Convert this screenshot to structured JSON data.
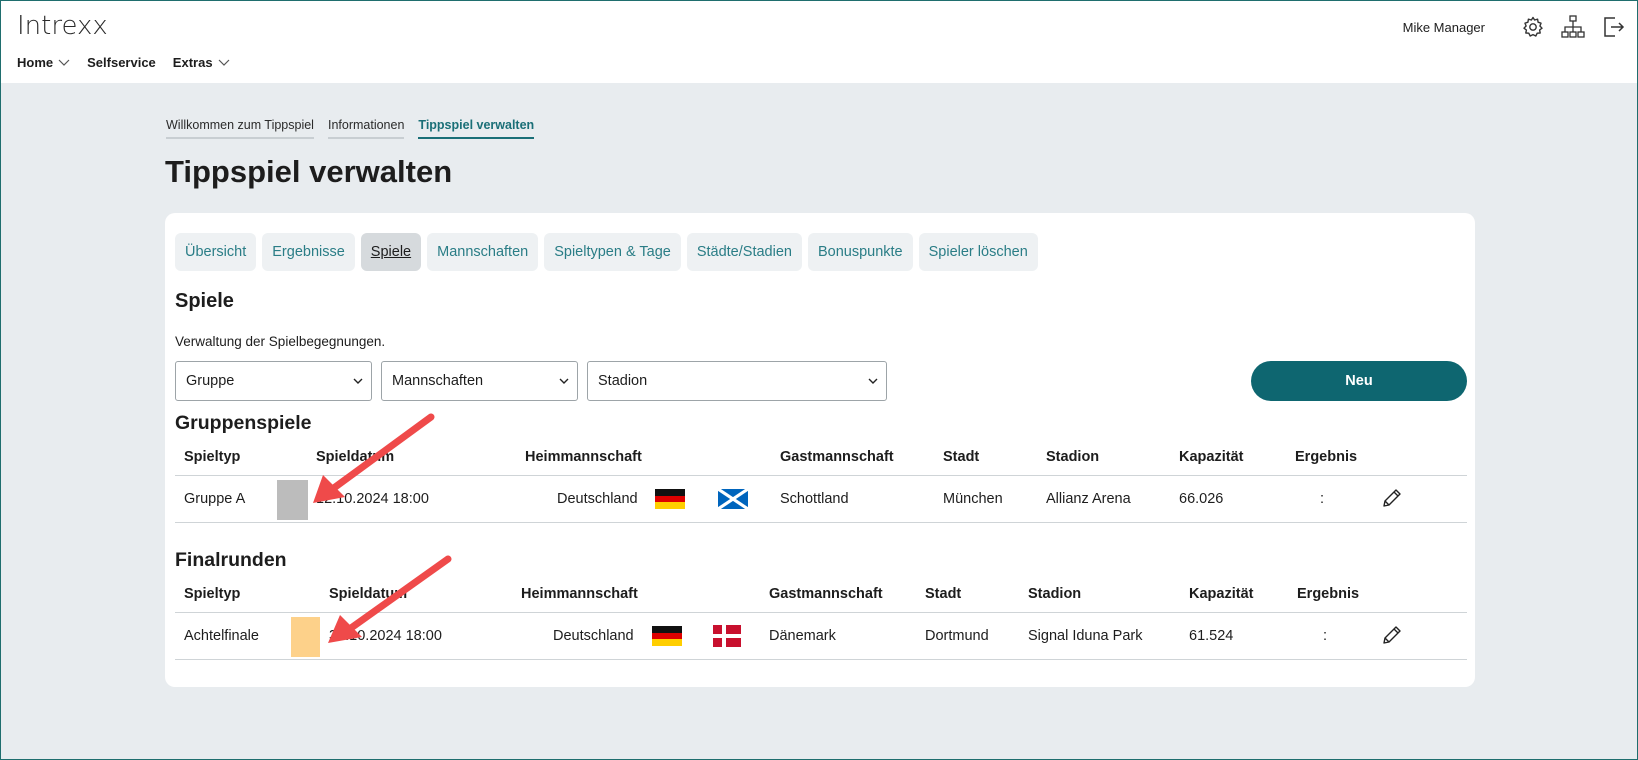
{
  "header": {
    "logo": "Intrexx",
    "nav": [
      {
        "label": "Home",
        "has_dropdown": true
      },
      {
        "label": "Selfservice",
        "has_dropdown": false
      },
      {
        "label": "Extras",
        "has_dropdown": true
      }
    ],
    "user_name": "Mike Manager",
    "icons": [
      "settings-icon",
      "sitemap-icon",
      "logout-icon"
    ]
  },
  "breadcrumbs": [
    {
      "label": "Willkommen zum Tippspiel",
      "active": false
    },
    {
      "label": "Informationen",
      "active": false
    },
    {
      "label": "Tippspiel verwalten",
      "active": true
    }
  ],
  "page_title": "Tippspiel verwalten",
  "tabs": [
    {
      "label": "Übersicht",
      "active": false
    },
    {
      "label": "Ergebnisse",
      "active": false
    },
    {
      "label": "Spiele",
      "active": true
    },
    {
      "label": "Mannschaften",
      "active": false
    },
    {
      "label": "Spieltypen & Tage",
      "active": false
    },
    {
      "label": "Städte/Stadien",
      "active": false
    },
    {
      "label": "Bonuspunkte",
      "active": false
    },
    {
      "label": "Spieler löschen",
      "active": false
    }
  ],
  "section": {
    "title": "Spiele",
    "description": "Verwaltung der Spielbegegnungen."
  },
  "filters": {
    "group": "Gruppe",
    "teams": "Mannschaften",
    "stadium": "Stadion",
    "new_button": "Neu"
  },
  "group_games": {
    "title": "Gruppenspiele",
    "columns": [
      "Spieltyp",
      "Spieldatum",
      "Heimmannschaft",
      "Gastmannschaft",
      "Stadt",
      "Stadion",
      "Kapazität",
      "Ergebnis"
    ],
    "rows": [
      {
        "type": "Gruppe A",
        "type_color": "#bcbcbc",
        "date": "12.10.2024 18:00",
        "home": "Deutschland",
        "home_flag": "germany-flag",
        "away_flag": "scotland-flag",
        "away": "Schottland",
        "city": "München",
        "stadium": "Allianz Arena",
        "capacity": "66.026",
        "result": ":"
      }
    ]
  },
  "final_games": {
    "title": "Finalrunden",
    "columns": [
      "Spieltyp",
      "Spieldatum",
      "Heimmannschaft",
      "Gastmannschaft",
      "Stadt",
      "Stadion",
      "Kapazität",
      "Ergebnis"
    ],
    "rows": [
      {
        "type": "Achtelfinale",
        "type_color": "#fdd18a",
        "date": "31.10.2024 18:00",
        "home": "Deutschland",
        "home_flag": "germany-flag",
        "away_flag": "denmark-flag",
        "away": "Dänemark",
        "city": "Dortmund",
        "stadium": "Signal Iduna Park",
        "capacity": "61.524",
        "result": ":"
      }
    ]
  },
  "colors": {
    "accent": "#0e6670",
    "tab_text": "#2a7d86",
    "annotation_arrow": "#ef4a4a"
  }
}
